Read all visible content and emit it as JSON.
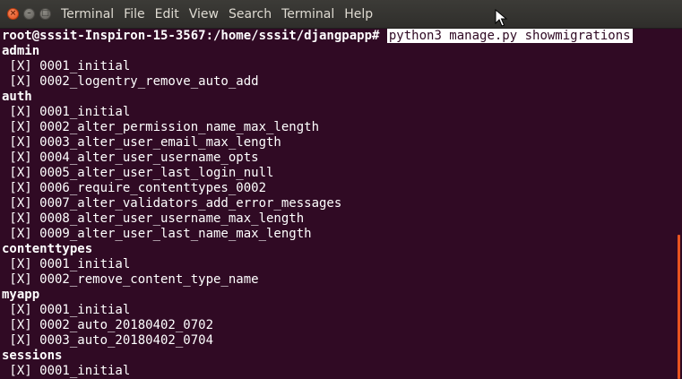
{
  "window": {
    "title": "Terminal",
    "menus": [
      "File",
      "Edit",
      "View",
      "Search",
      "Terminal",
      "Help"
    ],
    "close_glyph": "×",
    "min_glyph": "–",
    "max_glyph": "□"
  },
  "terminal": {
    "prompt": "root@sssit-Inspiron-15-3567:/home/sssit/djangpapp# ",
    "command": "python3 manage.py showmigrations",
    "lines": [
      {
        "text": "admin",
        "bold": true
      },
      {
        "text": " [X] 0001_initial",
        "bold": false
      },
      {
        "text": " [X] 0002_logentry_remove_auto_add",
        "bold": false
      },
      {
        "text": "auth",
        "bold": true
      },
      {
        "text": " [X] 0001_initial",
        "bold": false
      },
      {
        "text": " [X] 0002_alter_permission_name_max_length",
        "bold": false
      },
      {
        "text": " [X] 0003_alter_user_email_max_length",
        "bold": false
      },
      {
        "text": " [X] 0004_alter_user_username_opts",
        "bold": false
      },
      {
        "text": " [X] 0005_alter_user_last_login_null",
        "bold": false
      },
      {
        "text": " [X] 0006_require_contenttypes_0002",
        "bold": false
      },
      {
        "text": " [X] 0007_alter_validators_add_error_messages",
        "bold": false
      },
      {
        "text": " [X] 0008_alter_user_username_max_length",
        "bold": false
      },
      {
        "text": " [X] 0009_alter_user_last_name_max_length",
        "bold": false
      },
      {
        "text": "contenttypes",
        "bold": true
      },
      {
        "text": " [X] 0001_initial",
        "bold": false
      },
      {
        "text": " [X] 0002_remove_content_type_name",
        "bold": false
      },
      {
        "text": "myapp",
        "bold": true
      },
      {
        "text": " [X] 0001_initial",
        "bold": false
      },
      {
        "text": " [X] 0002_auto_20180402_0702",
        "bold": false
      },
      {
        "text": " [X] 0003_auto_20180402_0704",
        "bold": false
      },
      {
        "text": "sessions",
        "bold": true
      },
      {
        "text": " [X] 0001_initial",
        "bold": false
      }
    ]
  },
  "colors": {
    "background": "#300a24",
    "text": "#ffffff",
    "scrollbar": "#e95420",
    "titlebar": "#3c3b37"
  }
}
